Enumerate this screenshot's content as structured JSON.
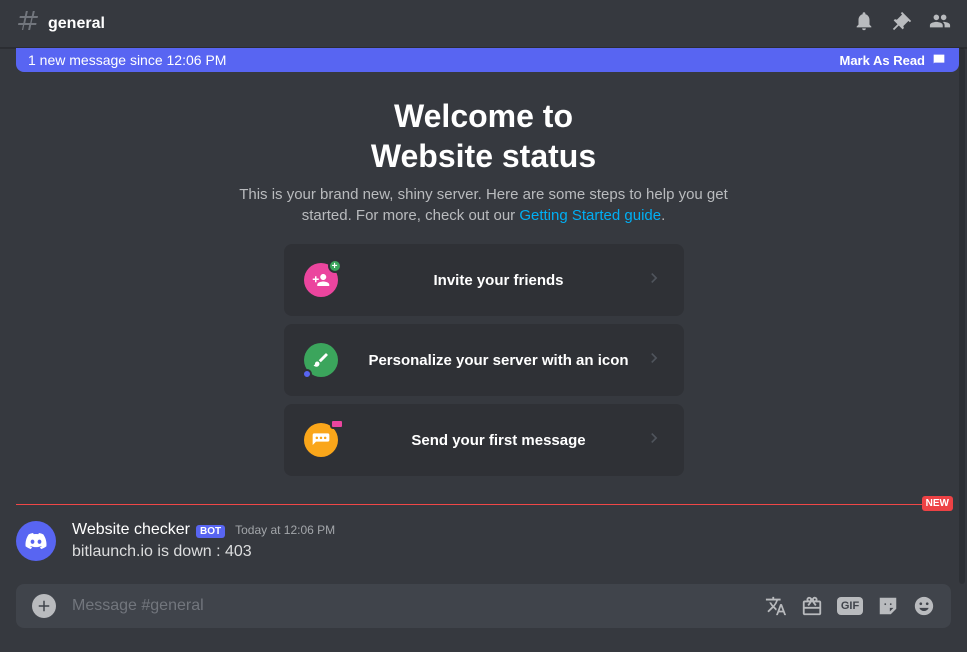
{
  "header": {
    "channel_name": "general"
  },
  "new_message_bar": {
    "text": "1 new message since 12:06 PM",
    "mark_read": "Mark As Read"
  },
  "welcome": {
    "title_line1": "Welcome to",
    "title_line2": "Website status",
    "description_part1": "This is your brand new, shiny server. Here are some steps to help you get started. For more, check out our ",
    "guide_link_text": "Getting Started guide",
    "description_part2": "."
  },
  "cards": [
    {
      "label": "Invite your friends",
      "icon": "invite"
    },
    {
      "label": "Personalize your server with an icon",
      "icon": "personalize"
    },
    {
      "label": "Send your first message",
      "icon": "message"
    }
  ],
  "divider": {
    "new_badge": "NEW"
  },
  "message": {
    "username": "Website checker",
    "bot_tag": "BOT",
    "timestamp": "Today at 12:06 PM",
    "text": "bitlaunch.io is down : 403"
  },
  "input": {
    "placeholder": "Message #general",
    "gif_label": "GIF"
  }
}
